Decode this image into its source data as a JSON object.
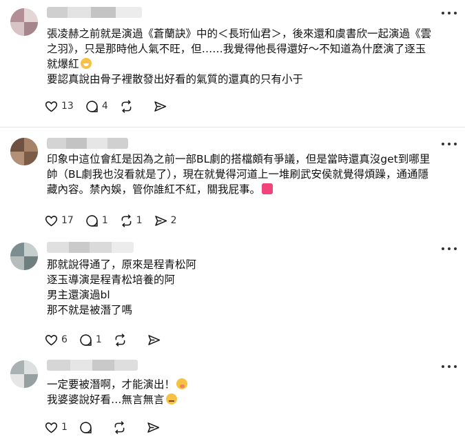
{
  "posts": [
    {
      "lines": [
        "張凌赫之前就是演過《蒼蘭訣》中的＜長珩仙君＞，後來還和虞書欣一起演過《雲",
        "之羽》，只是那時他人氣不旺，但……我覺得他長得還好～不知道為什麼演了逐玉",
        "就爆紅",
        "要認真說由骨子裡散發出好看的氣質的還真的只有小于"
      ],
      "emoji": "grinning-sweat-emoji",
      "like_count": "13",
      "reply_count": "4",
      "repost_count": "",
      "share_count": ""
    },
    {
      "lines": [
        "印象中這位會紅是因為之前一部BL劇的搭檔頗有爭議，但是當時還真沒get到哪里",
        "帥（BL劇我也沒看就是了），現在就覺得河道上一堆刷武安侯就覺得煩躁，通通隱",
        "藏內容。禁內娛，管你誰紅不紅，關我屁事。"
      ],
      "emoji": "anger-symbol-emoji",
      "like_count": "17",
      "reply_count": "1",
      "repost_count": "1",
      "share_count": "2"
    },
    {
      "lines": [
        "那就說得通了，原來是程青松阿",
        "逐玉導演是程青松培養的阿",
        "男主還演過bl",
        "那不就是被潛了嗎"
      ],
      "emoji": "",
      "like_count": "6",
      "reply_count": "1",
      "repost_count": "",
      "share_count": ""
    },
    {
      "lines": [
        "一定要被潛啊，才能演出！",
        "我婆婆說好看…無言無言"
      ],
      "emoji": "hush-emoji",
      "emoji2": "meh-emoji",
      "like_count": "1",
      "reply_count": "",
      "repost_count": "",
      "share_count": ""
    }
  ],
  "colors": {
    "text": "#101010",
    "icon": "#1a1a1a",
    "divider": "#e2e2e2"
  },
  "icons": [
    "heart-icon",
    "comment-icon",
    "repost-icon",
    "share-icon",
    "more-icon"
  ]
}
